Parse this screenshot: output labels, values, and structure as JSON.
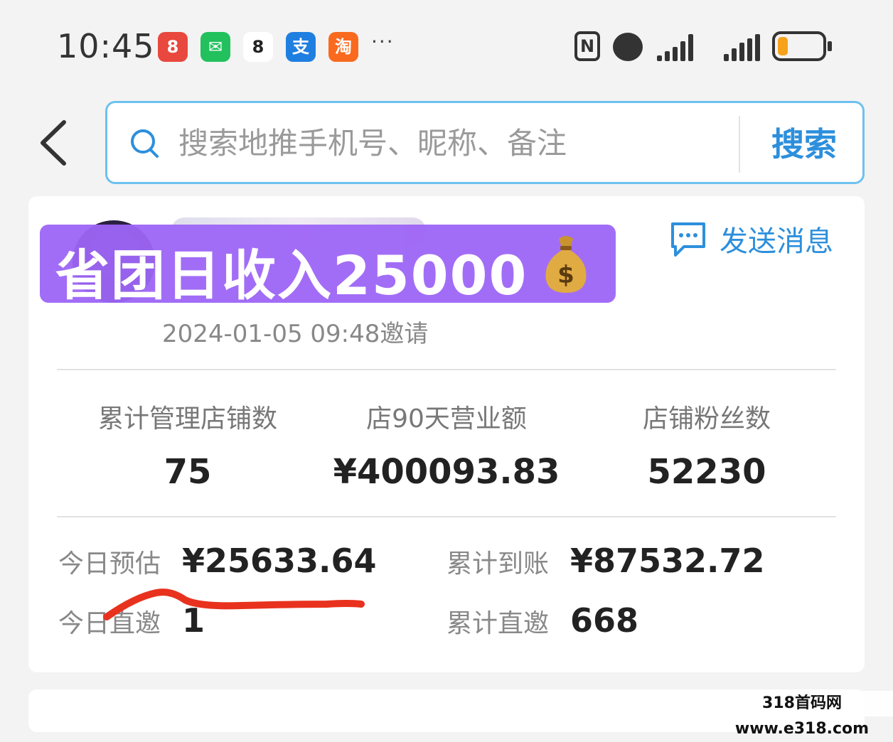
{
  "status_bar": {
    "time": "10:45",
    "apps": [
      {
        "name": "app-red",
        "glyph": "8",
        "color": "#e8483d"
      },
      {
        "name": "wechat",
        "glyph": "✉",
        "color": "#22c15e"
      },
      {
        "name": "app-white",
        "glyph": "8",
        "color": "#ffffff"
      },
      {
        "name": "alipay",
        "glyph": "支",
        "color": "#1f7fe0"
      },
      {
        "name": "taobao",
        "glyph": "淘",
        "color": "#f96a1f"
      }
    ],
    "more": "···"
  },
  "search": {
    "placeholder": "搜索地推手机号、昵称、备注",
    "button_label": "搜索"
  },
  "profile": {
    "invite_time": "2024-01-05 09:48邀请",
    "send_message_label": "发送消息"
  },
  "banner": {
    "text": "省团日收入25000"
  },
  "stats": [
    {
      "label": "累计管理店铺数",
      "value": "75"
    },
    {
      "label": "店90天营业额",
      "value": "¥400093.83"
    },
    {
      "label": "店铺粉丝数",
      "value": "52230"
    }
  ],
  "earnings": {
    "today_estimate_label": "今日预估",
    "today_estimate_value": "¥25633.64",
    "total_received_label": "累计到账",
    "total_received_value": "¥87532.72",
    "today_invites_label": "今日直邀",
    "today_invites_value": "1",
    "total_invites_label": "累计直邀",
    "total_invites_value": "668"
  },
  "watermark": "318首码网 www.e318.com",
  "colors": {
    "accent": "#2d8fdc",
    "search_border": "#6cc1ef",
    "banner": "#9d65f5",
    "annotation": "#e8321e"
  }
}
